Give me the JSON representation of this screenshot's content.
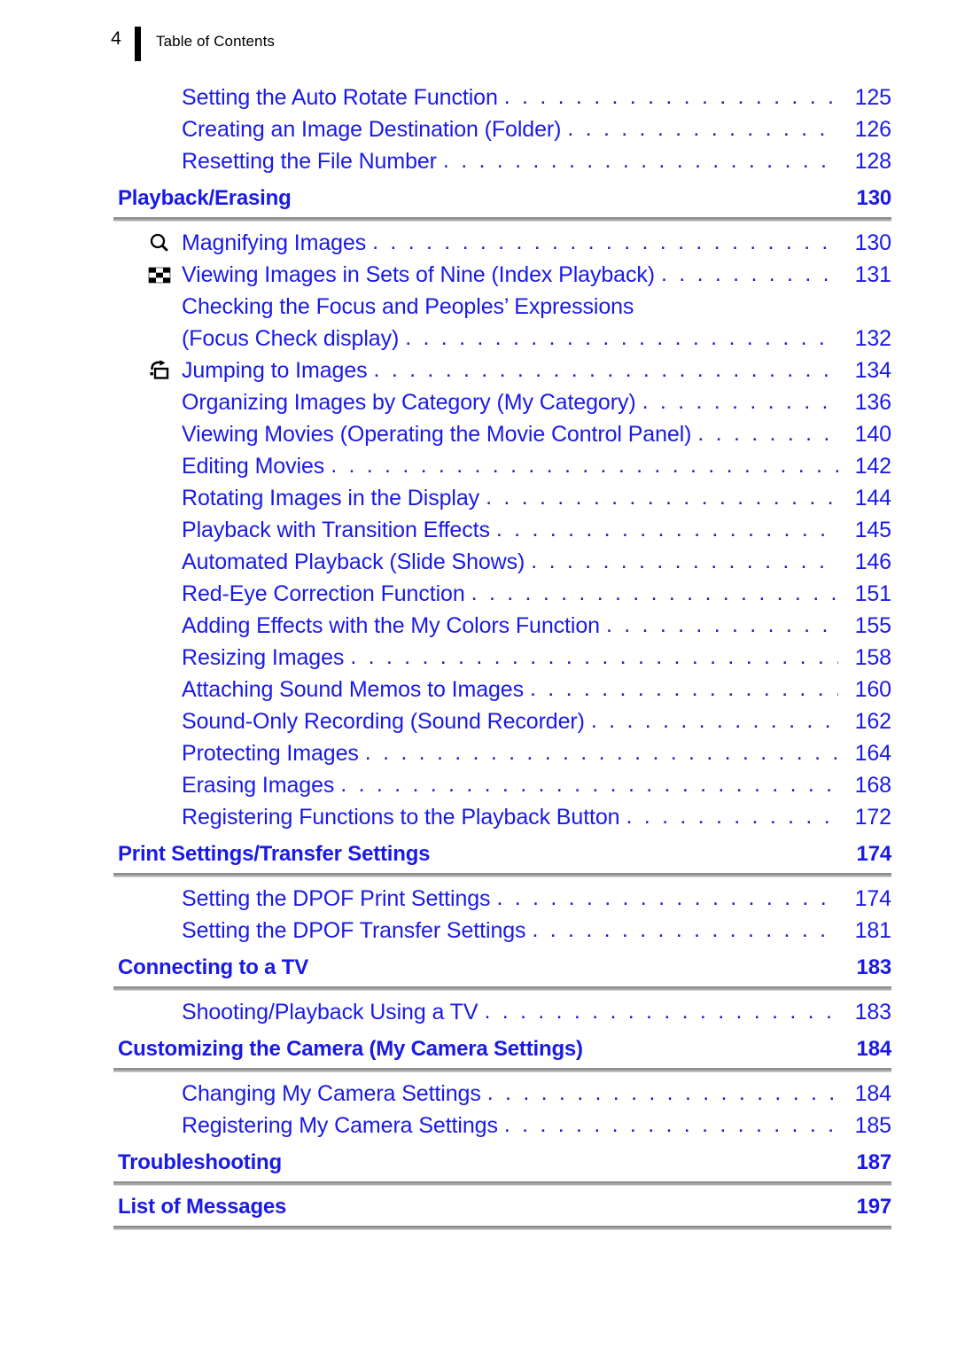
{
  "header": {
    "page_number": "4",
    "title": "Table of Contents"
  },
  "colors": {
    "text_blue": "#1a1ae6",
    "header_black": "#000000",
    "rule_gray": "#8c8c8c"
  },
  "toc": {
    "orphan_entries": [
      {
        "label": "Setting the Auto Rotate Function",
        "page": "125",
        "icon": null
      },
      {
        "label": "Creating an Image Destination (Folder)",
        "page": "126",
        "icon": null
      },
      {
        "label": "Resetting the File Number",
        "page": "128",
        "icon": null
      }
    ],
    "sections": [
      {
        "title": "Playback/Erasing",
        "page": "130",
        "entries": [
          {
            "label": "Magnifying Images",
            "page": "130",
            "icon": "magnifier-icon"
          },
          {
            "label": "Viewing Images in Sets of Nine (Index Playback)",
            "page": "131",
            "icon": "index-playback-icon"
          },
          {
            "label": "Checking the Focus and Peoples’ Expressions",
            "page": "",
            "icon": null,
            "wrap_first": true
          },
          {
            "label": "(Focus Check display)",
            "page": "132",
            "icon": null,
            "wrap_second": true
          },
          {
            "label": "Jumping to Images",
            "page": "134",
            "icon": "jump-icon"
          },
          {
            "label": "Organizing Images by Category (My Category)",
            "page": "136",
            "icon": null
          },
          {
            "label": "Viewing Movies (Operating the Movie Control Panel)",
            "page": "140",
            "icon": null
          },
          {
            "label": "Editing Movies",
            "page": "142",
            "icon": null
          },
          {
            "label": "Rotating Images in the Display",
            "page": "144",
            "icon": null
          },
          {
            "label": "Playback with Transition Effects",
            "page": "145",
            "icon": null
          },
          {
            "label": "Automated Playback (Slide Shows)",
            "page": "146",
            "icon": null
          },
          {
            "label": "Red-Eye Correction Function",
            "page": "151",
            "icon": null
          },
          {
            "label": "Adding Effects with the My Colors Function",
            "page": "155",
            "icon": null
          },
          {
            "label": "Resizing Images",
            "page": "158",
            "icon": null
          },
          {
            "label": "Attaching Sound Memos to Images",
            "page": "160",
            "icon": null
          },
          {
            "label": "Sound-Only Recording (Sound Recorder)",
            "page": "162",
            "icon": null
          },
          {
            "label": "Protecting Images",
            "page": "164",
            "icon": null
          },
          {
            "label": "Erasing Images",
            "page": "168",
            "icon": null
          },
          {
            "label": "Registering Functions to the Playback Button",
            "page": "172",
            "icon": null
          }
        ]
      },
      {
        "title": "Print Settings/Transfer Settings",
        "page": "174",
        "entries": [
          {
            "label": "Setting the DPOF Print Settings",
            "page": "174",
            "icon": null
          },
          {
            "label": "Setting the DPOF Transfer Settings",
            "page": "181",
            "icon": null
          }
        ]
      },
      {
        "title": "Connecting to a TV",
        "page": "183",
        "entries": [
          {
            "label": "Shooting/Playback Using a TV",
            "page": "183",
            "icon": null
          }
        ]
      },
      {
        "title": "Customizing the Camera (My Camera Settings)",
        "page": "184",
        "entries": [
          {
            "label": "Changing My Camera Settings",
            "page": "184",
            "icon": null
          },
          {
            "label": "Registering My Camera Settings",
            "page": "185",
            "icon": null
          }
        ]
      },
      {
        "title": "Troubleshooting",
        "page": "187",
        "entries": []
      },
      {
        "title": "List of Messages",
        "page": "197",
        "entries": []
      }
    ]
  },
  "leader_dots": ". . . . . . . . . . . . . . . . . . . . . . . . . . . . . . . . . . . . . . . . . . . . . . . . . . . . . . . . . . . . . ."
}
